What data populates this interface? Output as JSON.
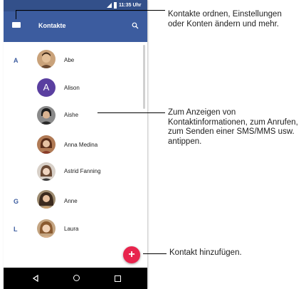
{
  "status_bar": {
    "time": "11:35 Uhr"
  },
  "app_bar": {
    "title": "Kontakte",
    "menu_icon": "menu-icon",
    "search_icon": "search-icon"
  },
  "contacts": [
    {
      "section": "A",
      "name": "Abe",
      "avatar": "photo"
    },
    {
      "section": "",
      "name": "Alison",
      "avatar": "letter",
      "avatar_letter": "A",
      "avatar_color": "#5a3fa0"
    },
    {
      "section": "",
      "name": "Aishe",
      "avatar": "photo"
    },
    {
      "section": "",
      "name": "Anna Medina",
      "avatar": "photo"
    },
    {
      "section": "",
      "name": "Astrid Fanning",
      "avatar": "photo"
    },
    {
      "section": "G",
      "name": "Anne",
      "avatar": "photo"
    },
    {
      "section": "L",
      "name": "Laura",
      "avatar": "photo"
    }
  ],
  "fab": {
    "label": "+",
    "color": "#e8244d"
  },
  "nav_bar": {
    "back": "back-icon",
    "home": "home-icon",
    "recent": "recent-apps-icon"
  },
  "callouts": {
    "menu": "Kontakte ordnen, Einstellungen oder Konten ändern und mehr.",
    "contact": "Zum Anzeigen von Kontaktinformationen, zum Anrufen, zum Senden einer SMS/MMS usw. antippen.",
    "add": "Kontakt hinzufügen."
  },
  "colors": {
    "app_bar": "#3c5c9f",
    "status_bar": "#33508a",
    "section_letter": "#3c5c9f"
  }
}
